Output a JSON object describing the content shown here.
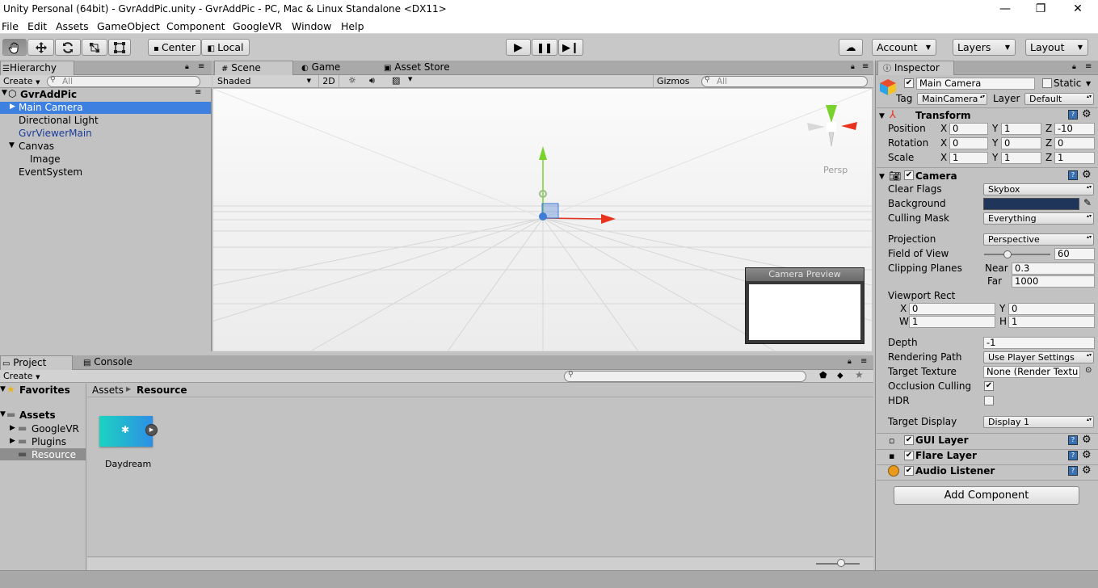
{
  "window": {
    "title": "Unity Personal (64bit) - GvrAddPic.unity - GvrAddPic - PC, Mac & Linux Standalone <DX11>",
    "minimize": "—",
    "maximize": "❐",
    "close": "✕"
  },
  "menu": [
    "File",
    "Edit",
    "Assets",
    "GameObject",
    "Component",
    "GoogleVR",
    "Window",
    "Help"
  ],
  "toolbar": {
    "center": "Center",
    "local": "Local",
    "account": "Account",
    "layers": "Layers",
    "layout": "Layout",
    "tools": [
      "hand-tool-icon",
      "move-tool-icon",
      "rotate-tool-icon",
      "scale-tool-icon",
      "rect-tool-icon"
    ]
  },
  "hierarchy": {
    "tab": "Hierarchy",
    "create": "Create",
    "search_placeholder": "All",
    "scene": "GvrAddPic",
    "items": [
      {
        "label": "Main Camera",
        "selected": true
      },
      {
        "label": "Directional Light"
      },
      {
        "label": "GvrViewerMain",
        "prefab": true
      },
      {
        "label": "Canvas"
      },
      {
        "label": "Image"
      },
      {
        "label": "EventSystem"
      }
    ]
  },
  "scene": {
    "tabs": [
      "Scene",
      "Game",
      "Asset Store"
    ],
    "shading": "Shaded",
    "mode_2d": "2D",
    "gizmos": "Gizmos",
    "search_placeholder": "All",
    "persp": "Persp",
    "camera_preview_title": "Camera Preview"
  },
  "project": {
    "tabs": [
      "Project",
      "Console"
    ],
    "create": "Create",
    "favorites": "Favorites",
    "assets": "Assets",
    "folders": [
      "GoogleVR",
      "Plugins",
      "Resource"
    ],
    "breadcrumb": [
      "Assets",
      "Resource"
    ],
    "asset_name": "Daydream"
  },
  "inspector": {
    "tab": "Inspector",
    "object_name": "Main Camera",
    "static": "Static",
    "tag_label": "Tag",
    "tag": "MainCamera",
    "layer_label": "Layer",
    "layer": "Default",
    "transform": {
      "title": "Transform",
      "position": {
        "label": "Position",
        "x": "0",
        "y": "1",
        "z": "-10"
      },
      "rotation": {
        "label": "Rotation",
        "x": "0",
        "y": "0",
        "z": "0"
      },
      "scale": {
        "label": "Scale",
        "x": "1",
        "y": "1",
        "z": "1"
      }
    },
    "camera": {
      "title": "Camera",
      "clear_flags": {
        "label": "Clear Flags",
        "value": "Skybox"
      },
      "background": {
        "label": "Background",
        "color": "#1f3559"
      },
      "culling_mask": {
        "label": "Culling Mask",
        "value": "Everything"
      },
      "projection": {
        "label": "Projection",
        "value": "Perspective"
      },
      "fov": {
        "label": "Field of View",
        "value": "60",
        "fraction": 0.35
      },
      "clipping": {
        "label": "Clipping Planes",
        "near_label": "Near",
        "near": "0.3",
        "far_label": "Far",
        "far": "1000"
      },
      "viewport": {
        "label": "Viewport Rect",
        "x": "0",
        "y": "0",
        "w": "1",
        "h": "1"
      },
      "depth": {
        "label": "Depth",
        "value": "-1"
      },
      "rendering_path": {
        "label": "Rendering Path",
        "value": "Use Player Settings"
      },
      "target_texture": {
        "label": "Target Texture",
        "value": "None (Render Textu"
      },
      "occlusion_culling": {
        "label": "Occlusion Culling",
        "checked": true
      },
      "hdr": {
        "label": "HDR",
        "checked": false
      },
      "target_display": {
        "label": "Target Display",
        "value": "Display 1"
      }
    },
    "components": [
      "GUI Layer",
      "Flare Layer",
      "Audio Listener"
    ],
    "add_component": "Add Component"
  },
  "colors": {
    "selection": "#3d80df",
    "prefab_text": "#1a3c9c",
    "x_axis": "#e8321d",
    "y_axis": "#7ad32c",
    "z_axis": "#3f7cd8"
  }
}
